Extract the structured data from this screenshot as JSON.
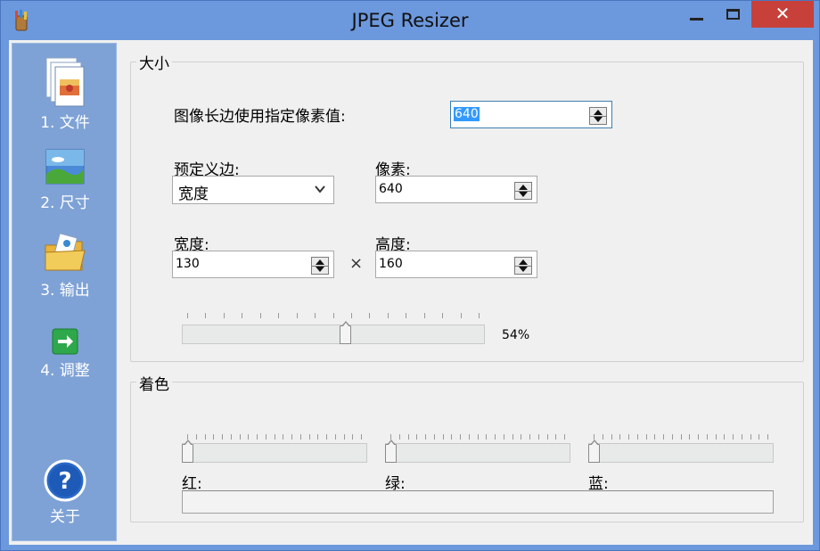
{
  "window": {
    "title": "JPEG Resizer",
    "close_glyph": "✕"
  },
  "sidebar": {
    "items": [
      {
        "label": "1. 文件",
        "icon": "files-icon"
      },
      {
        "label": "2. 尺寸",
        "icon": "picture-size-icon"
      },
      {
        "label": "3. 输出",
        "icon": "output-folder-icon"
      },
      {
        "label": "4. 调整",
        "icon": "next-arrow-icon"
      },
      {
        "label": "关于",
        "icon": "help-icon"
      }
    ]
  },
  "size_group": {
    "title": "大小",
    "long_side_label": "图像长边使用指定像素值:",
    "long_side_value": "640",
    "preset_side_label": "预定义边:",
    "preset_side_value": "宽度",
    "pixels_label": "像素:",
    "pixels_value": "640",
    "width_label": "宽度:",
    "width_value": "130",
    "times_symbol": "×",
    "height_label": "高度:",
    "height_value": "160",
    "scale_percent_label": "54%",
    "scale_percent": 54
  },
  "tint_group": {
    "title": "着色",
    "red_label": "红:",
    "green_label": "绿:",
    "blue_label": "蓝:",
    "red_value": 0,
    "green_value": 0,
    "blue_value": 0
  }
}
